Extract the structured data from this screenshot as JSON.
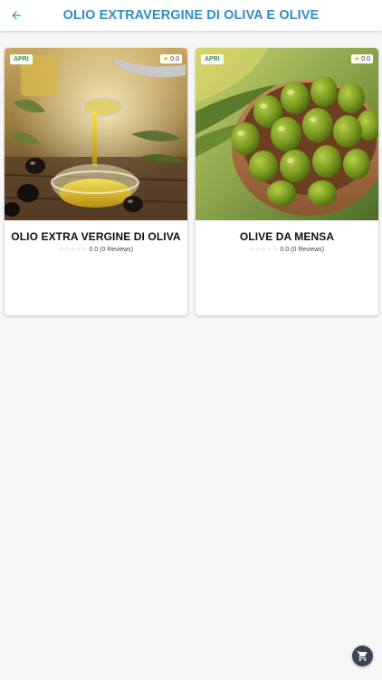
{
  "header": {
    "title": "OLIO EXTRAVERGINE DI OLIVA E OLIVE",
    "back_icon": "arrow-left-icon"
  },
  "colors": {
    "title": "#2f8fc3",
    "badge_open": "#3b8d3b",
    "fab": "#3c4653"
  },
  "products": [
    {
      "badge": "APRI",
      "rating_badge": "0.0",
      "name": "OLIO EXTRA VERGINE DI OLIVA",
      "stars": "☆☆☆☆☆",
      "rating_text": "0.0 (0 Reviews)",
      "image": "olive-oil-pouring-image"
    },
    {
      "badge": "APRI",
      "rating_badge": "0.0",
      "name": "OLIVE DA MENSA",
      "stars": "☆☆☆☆☆",
      "rating_text": "0.0 (0 Reviews)",
      "image": "green-olives-bowl-image"
    }
  ],
  "fab": {
    "icon": "cart-icon"
  }
}
